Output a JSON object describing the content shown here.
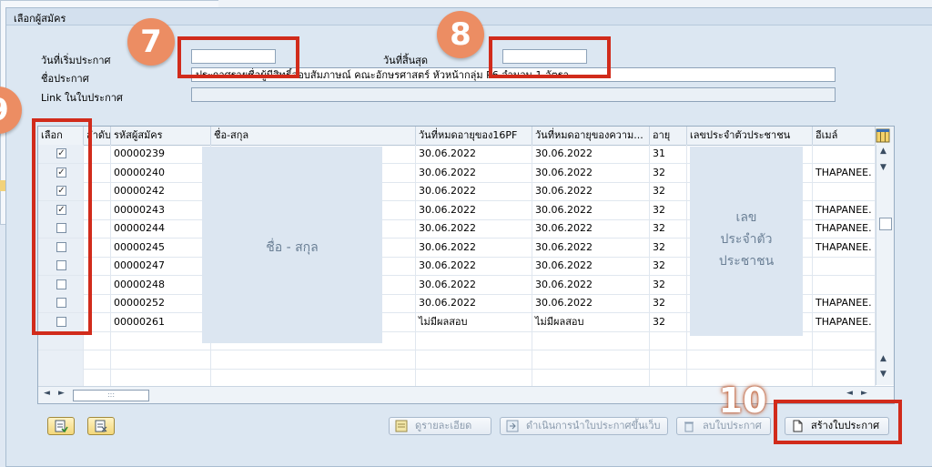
{
  "dialog": {
    "title": "เลือกผู้สมัคร"
  },
  "form": {
    "start_date_label": "วันที่เริ่มประกาศ",
    "start_date_value": "",
    "end_date_label": "วันที่สิ้นสุด",
    "end_date_value": "",
    "announce_name_label": "ชื่อประกาศ",
    "announce_name_value": "ประกาศรายชื่อผู้มีสิทธิ์สอบสัมภาษณ์ คณะอักษรศาสตร์ หัวหน้ากลุ่ม P6 จำนวน 1 อัตรา",
    "link_label": "Link ในใบประกาศ",
    "link_value": ""
  },
  "annotations": {
    "step7": "7",
    "step8": "8",
    "step9": "9",
    "step10": "10"
  },
  "table": {
    "headers": [
      "เลือก",
      "ลำดับ",
      "รหัสผู้สมัคร",
      "ชื่อ-สกุล",
      "วันที่หมดอายุของ16PF",
      "วันที่หมดอายุของความ...",
      "อายุ",
      "เลขประจำตัวประชาชน",
      "อีเมล์"
    ],
    "rows": [
      {
        "checked": true,
        "id": "00000239",
        "pf": "30.06.2022",
        "exp": "30.06.2022",
        "age": "31",
        "email": ""
      },
      {
        "checked": true,
        "id": "00000240",
        "pf": "30.06.2022",
        "exp": "30.06.2022",
        "age": "32",
        "email": "THAPANEE."
      },
      {
        "checked": true,
        "id": "00000242",
        "pf": "30.06.2022",
        "exp": "30.06.2022",
        "age": "32",
        "email": ""
      },
      {
        "checked": true,
        "id": "00000243",
        "pf": "30.06.2022",
        "exp": "30.06.2022",
        "age": "32",
        "email": "THAPANEE."
      },
      {
        "checked": false,
        "id": "00000244",
        "pf": "30.06.2022",
        "exp": "30.06.2022",
        "age": "32",
        "email": "THAPANEE."
      },
      {
        "checked": false,
        "id": "00000245",
        "pf": "30.06.2022",
        "exp": "30.06.2022",
        "age": "32",
        "email": "THAPANEE."
      },
      {
        "checked": false,
        "id": "00000247",
        "pf": "30.06.2022",
        "exp": "30.06.2022",
        "age": "32",
        "email": ""
      },
      {
        "checked": false,
        "id": "00000248",
        "pf": "30.06.2022",
        "exp": "30.06.2022",
        "age": "32",
        "email": ""
      },
      {
        "checked": false,
        "id": "00000252",
        "pf": "30.06.2022",
        "exp": "30.06.2022",
        "age": "32",
        "email": "THAPANEE."
      },
      {
        "checked": false,
        "id": "00000261",
        "pf": "ไม่มีผลสอบ",
        "exp": "ไม่มีผลสอบ",
        "age": "32",
        "email": "THAPANEE."
      }
    ],
    "name_mask": "ชื่อ - สกุล",
    "id_mask": [
      "เลข",
      "ประจำตัว",
      "ประชาชน"
    ],
    "hscroll_grip": ":::"
  },
  "buttons": {
    "details": "ดูรายละเอียด",
    "publish_web": "ดำเนินการนำใบประกาศขึ้นเว็บ",
    "delete": "ลบใบประกาศ",
    "create": "สร้างใบประกาศ"
  },
  "colors": {
    "annotation_red": "#d12b1b",
    "badge_orange": "#ec8d63"
  }
}
